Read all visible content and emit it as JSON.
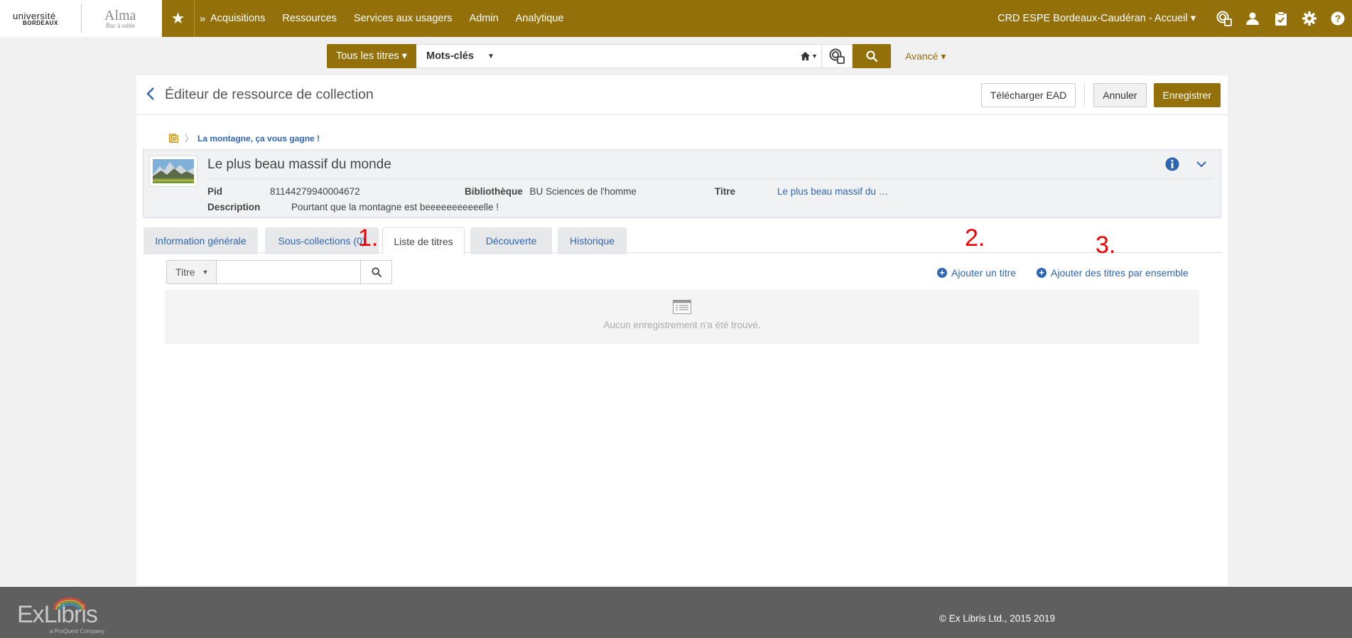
{
  "brand": {
    "university_line1": "université",
    "university_line2": "BORDEAUX",
    "app_name": "Alma",
    "app_env": "Bac à sable"
  },
  "topnav": {
    "items": [
      "Acquisitions",
      "Ressources",
      "Services aux usagers",
      "Admin",
      "Analytique"
    ],
    "institution": "CRD ESPE Bordeaux-Caudéran - Accueil ▾"
  },
  "search": {
    "scope": "Tous les titres ▾",
    "field": "Mots-clés",
    "query": "",
    "advanced": "Avancé ▾"
  },
  "page": {
    "title": "Éditeur de ressource de collection",
    "buttons": {
      "download": "Télécharger EAD",
      "cancel": "Annuler",
      "save": "Enregistrer"
    },
    "breadcrumb": "La montagne, ça vous gagne !"
  },
  "record": {
    "title": "Le plus beau massif du monde",
    "fields": [
      {
        "label": "Pid",
        "value": "81144279940004672"
      },
      {
        "label": "Bibliothèque",
        "value": "BU Sciences de l'homme"
      },
      {
        "label": "Titre",
        "value": "Le plus beau massif du …"
      },
      {
        "label": "Description",
        "value": "Pourtant que la montagne est beeeeeeeeeeelle !"
      }
    ]
  },
  "tabs": [
    "Information générale",
    "Sous-collections (0)",
    "Liste de titres",
    "Découverte",
    "Historique"
  ],
  "active_tab": "Liste de titres",
  "annotations": [
    "1.",
    "2.",
    "3."
  ],
  "list": {
    "filter_field": "Titre",
    "filter_value": "",
    "add_title": "Ajouter un titre",
    "add_titles_bulk": "Ajouter des titres par ensemble",
    "empty_message": "Aucun enregistrement n'a été trouvé."
  },
  "footer": {
    "brand": "ExLibris",
    "brand_sub": "a ProQuest Company",
    "copyright": "© Ex Libris Ltd., 2015 2019"
  },
  "colors": {
    "accent": "#93700a",
    "link": "#2f66b3",
    "annotation": "#e00000"
  }
}
